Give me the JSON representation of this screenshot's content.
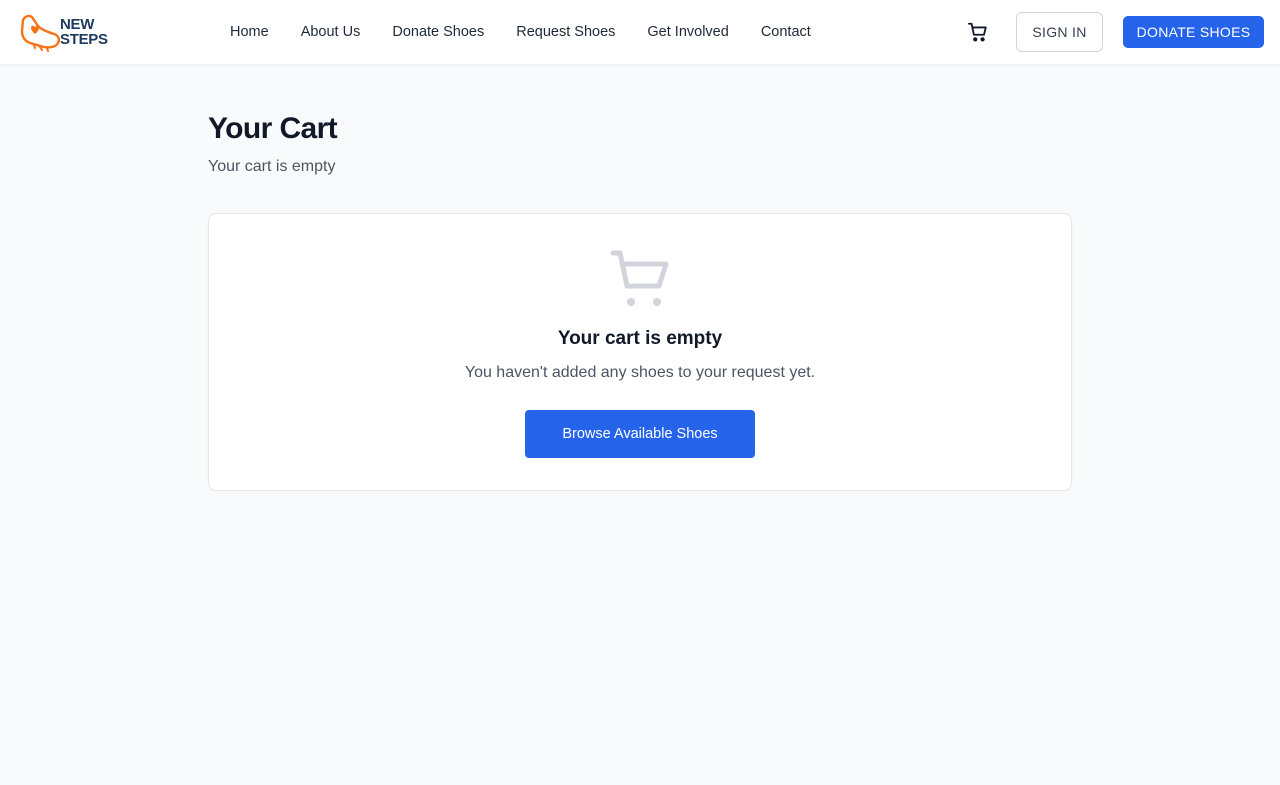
{
  "brand": {
    "line1": "NEW",
    "line2": "STEPS",
    "accent_color": "#f97316",
    "text_color": "#1e3a5f",
    "logo_icon": "shoe-heart-icon"
  },
  "nav": {
    "links": [
      {
        "label": "Home"
      },
      {
        "label": "About Us"
      },
      {
        "label": "Donate Shoes"
      },
      {
        "label": "Request Shoes"
      },
      {
        "label": "Get Involved"
      },
      {
        "label": "Contact"
      }
    ],
    "cart_icon": "shopping-cart-icon",
    "signin_label": "SIGN IN",
    "donate_label": "DONATE SHOES"
  },
  "page": {
    "title": "Your Cart",
    "subtitle": "Your cart is empty"
  },
  "empty_state": {
    "icon": "shopping-cart-icon",
    "title": "Your cart is empty",
    "description": "You haven't added any shoes to your request yet.",
    "button_label": "Browse Available Shoes"
  },
  "colors": {
    "primary": "#2563eb",
    "background": "#f9fafb",
    "muted_icon": "#d1d5db"
  }
}
